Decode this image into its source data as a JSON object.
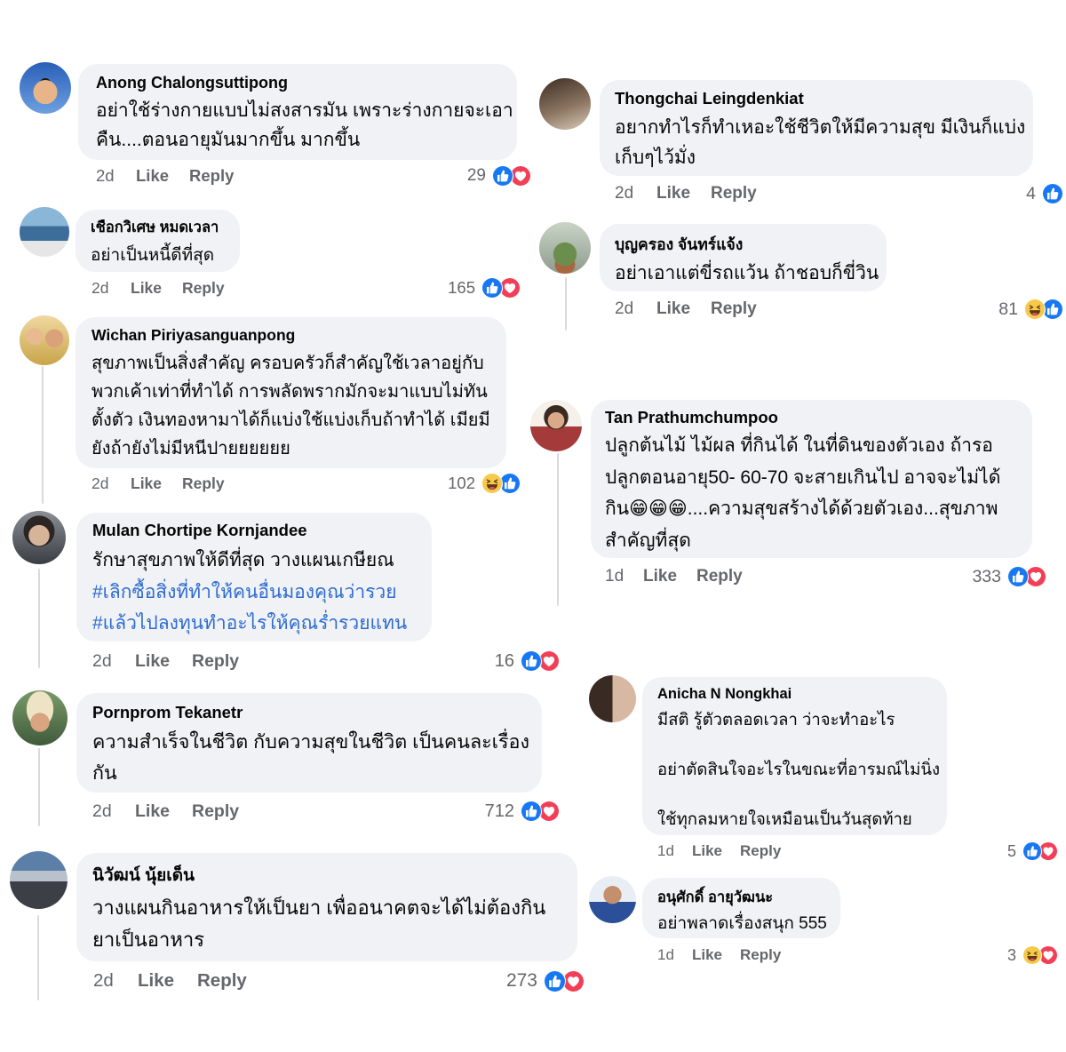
{
  "colors": {
    "bubble_bg": "#f0f2f5",
    "text": "#050505",
    "meta_text": "#65676b",
    "hashtag": "#2d6bd2",
    "like_reaction": "#1877f2",
    "love_reaction": "#f33e58",
    "haha_reaction": "#f7c94b"
  },
  "left_column": [
    {
      "author": "Anong Chalongsuttipong",
      "lines": [
        "อย่าใช้ร่างกายแบบไม่สงสารมัน  เพราะร่างกายจะเอา",
        "คืน....ตอนอายุมันมากขึ้น มากขึ้น"
      ],
      "time": "2d",
      "like_label": "Like",
      "reply_label": "Reply",
      "reaction_count": "29",
      "reactions": [
        "like",
        "love"
      ]
    },
    {
      "author": "เชือกวิเศษ หมดเวลา",
      "lines": [
        "อย่าเป็นหนี้ดีที่สุด"
      ],
      "time": "2d",
      "like_label": "Like",
      "reply_label": "Reply",
      "reaction_count": "165",
      "reactions": [
        "like",
        "love"
      ]
    },
    {
      "author": "Wichan Piriyasanguanpong",
      "lines": [
        "สุขภาพเป็นสิ่งสำคัญ ครอบครัวก็สำคัญใช้เวลาอยู่กับ",
        "พวกเค้าเท่าที่ทำได้ การพลัดพรากมักจะมาแบบไม่ทัน",
        "ตั้งตัว เงินทองหามาได้ก็แบ่งใช้แบ่งเก็บถ้าทำได้ เมียมี",
        "ยังถ้ายังไม่มีหนีปายยยยยย"
      ],
      "time": "2d",
      "like_label": "Like",
      "reply_label": "Reply",
      "reaction_count": "102",
      "reactions": [
        "haha",
        "like"
      ]
    },
    {
      "author": "Mulan Chortipe Kornjandee",
      "lines": [
        "รักษาสุขภาพให้ดีที่สุด วางแผนเกษียณ"
      ],
      "hashtags": [
        "#เลิกซื้อสิ่งที่ทำให้คนอื่นมองคุณว่ารวย",
        "#แล้วไปลงทุนทำอะไรให้คุณร่ำรวยแทน"
      ],
      "time": "2d",
      "like_label": "Like",
      "reply_label": "Reply",
      "reaction_count": "16",
      "reactions": [
        "like",
        "love"
      ]
    },
    {
      "author": "Pornprom Tekanetr",
      "lines": [
        "ความสำเร็จในชีวิต กับความสุขในชีวิต เป็นคนละเรื่อง",
        "กัน"
      ],
      "time": "2d",
      "like_label": "Like",
      "reply_label": "Reply",
      "reaction_count": "712",
      "reactions": [
        "like",
        "love"
      ]
    },
    {
      "author": "นิวัฒน์ นุ้ยเด็น",
      "lines": [
        "วางแผนกินอาหารให้เป็นยา เพื่ออนาคตจะได้ไม่ต้องกิน",
        "ยาเป็นอาหาร"
      ],
      "time": "2d",
      "like_label": "Like",
      "reply_label": "Reply",
      "reaction_count": "273",
      "reactions": [
        "like",
        "love"
      ]
    }
  ],
  "right_column": [
    {
      "author": "Thongchai Leingdenkiat",
      "lines": [
        "อยากทำไรก็ทำเหอะใช้ชีวิตให้มีความสุข มีเงินก็แบ่ง",
        "เก็บๆไว้มั่ง"
      ],
      "time": "2d",
      "like_label": "Like",
      "reply_label": "Reply",
      "reaction_count": "4",
      "reactions": [
        "like"
      ]
    },
    {
      "author": "บุญครอง จันทร์แจ้ง",
      "lines": [
        "อย่าเอาแต่ขี่รถแว้น ถ้าชอบก็ขี่วิน"
      ],
      "time": "2d",
      "like_label": "Like",
      "reply_label": "Reply",
      "reaction_count": "81",
      "reactions": [
        "haha",
        "like"
      ]
    },
    {
      "author": "Tan Prathumchumpoo",
      "lines": [
        "ปลูกต้นไม้  ไม้ผล ที่กินได้  ในที่ดินของตัวเอง ถ้ารอ",
        "ปลูกตอนอายุ50- 60-70  จะสายเกินไป   อาจจะไม่ได้",
        "กิน😁😁😁....ความสุขสร้างได้ด้วยตัวเอง...สุขภาพ",
        "สำคัญที่สุด"
      ],
      "time": "1d",
      "like_label": "Like",
      "reply_label": "Reply",
      "reaction_count": "333",
      "reactions": [
        "like",
        "love"
      ]
    },
    {
      "author": "Anicha N Nongkhai",
      "lines": [
        "มีสติ รู้ตัวตลอดเวลา ว่าจะทำอะไร",
        "อย่าตัดสินใจอะไรในขณะที่อารมณ์ไม่นิ่ง",
        "ใช้ทุกลมหายใจเหมือนเป็นวันสุดท้าย"
      ],
      "time": "1d",
      "like_label": "Like",
      "reply_label": "Reply",
      "reaction_count": "5",
      "reactions": [
        "like",
        "love"
      ]
    },
    {
      "author": "อนุศักดิ์ อายุวัฒนะ",
      "lines": [
        "อย่าพลาดเรื่องสนุก 555"
      ],
      "time": "1d",
      "like_label": "Like",
      "reply_label": "Reply",
      "reaction_count": "3",
      "reactions": [
        "haha",
        "love"
      ]
    }
  ]
}
